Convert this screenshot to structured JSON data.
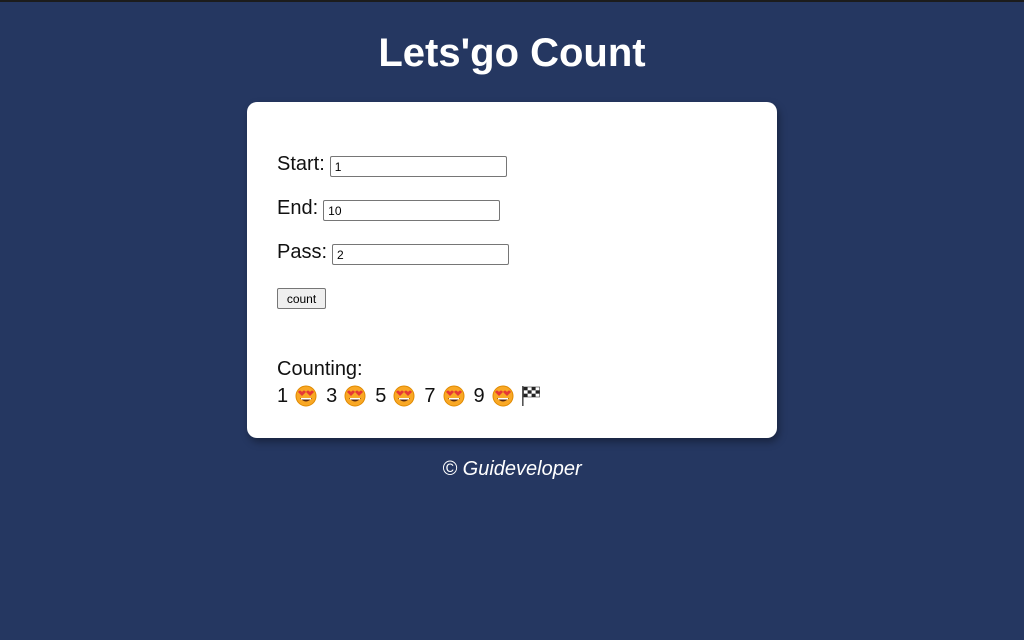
{
  "page": {
    "title": "Lets'go Count",
    "footer": "© Guideveloper"
  },
  "form": {
    "start_label": "Start:",
    "start_value": "1",
    "end_label": "End:",
    "end_value": "10",
    "pass_label": "Pass:",
    "pass_value": "2",
    "count_button": "count"
  },
  "result": {
    "label": "Counting:",
    "numbers": [
      "1",
      "3",
      "5",
      "7",
      "9"
    ],
    "separator_icon": "heart-eyes-emoji-icon",
    "end_icon": "checkered-flag-icon"
  },
  "colors": {
    "background": "#253761",
    "card": "#ffffff",
    "text_light": "#ffffff"
  }
}
